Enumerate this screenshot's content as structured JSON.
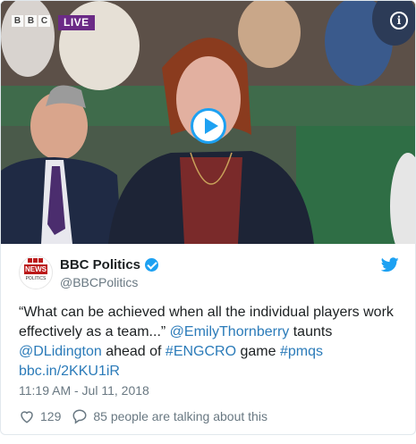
{
  "media": {
    "live_label": "LIVE",
    "bbc_letters": [
      "B",
      "B",
      "C"
    ],
    "info_icon": "info-icon",
    "play_icon": "play-icon"
  },
  "author": {
    "display_name": "BBC Politics",
    "handle": "@BBCPolitics",
    "avatar_text_news": "NEWS",
    "avatar_text_politics": "POLITICS",
    "verified": true
  },
  "tweet": {
    "text_part1": "“What can be achieved when all the individual players work effectively as a team...” ",
    "mention1": "@EmilyThornberry",
    "text_part2": " taunts ",
    "mention2": "@DLidington",
    "text_part3": " ahead of ",
    "hashtag1": "#ENGCRO",
    "text_part4": " game ",
    "hashtag2": "#pmqs",
    "link": "bbc.in/2KKU1iR"
  },
  "timestamp": "11:19 AM - Jul 11, 2018",
  "actions": {
    "likes": "129",
    "talking": "85 people are talking about this"
  },
  "colors": {
    "link": "#2b7bb9",
    "twitter_blue": "#1da1f2",
    "live_purple": "#6b2a86",
    "bbc_red": "#bb1919"
  }
}
